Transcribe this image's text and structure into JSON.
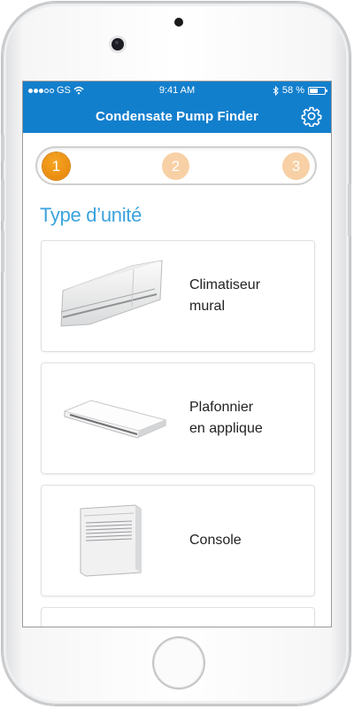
{
  "status_bar": {
    "carrier": "GS",
    "time": "9:41 AM",
    "battery_percent": "58 %",
    "battery_level": 0.58,
    "signal_icon": "signal-dots-icon",
    "wifi_icon": "wifi-icon",
    "bluetooth_icon": "bluetooth-icon"
  },
  "nav": {
    "title": "Condensate Pump Finder",
    "settings_icon": "gear-icon"
  },
  "stepper": {
    "steps": [
      "1",
      "2",
      "3"
    ],
    "active_index": 0
  },
  "section_title": "Type d’unité",
  "unit_types": [
    {
      "label": "Climatiseur\nmural",
      "image": "wall-mounted-ac-icon"
    },
    {
      "label": "Plafonnier\nen applique",
      "image": "ceiling-cassette-icon"
    },
    {
      "label": "Console",
      "image": "console-unit-icon"
    }
  ],
  "colors": {
    "brand_blue": "#127fcd",
    "title_blue": "#3aa3de",
    "active_step": "#f39a1b",
    "inactive_step": "#f8d0a5"
  }
}
